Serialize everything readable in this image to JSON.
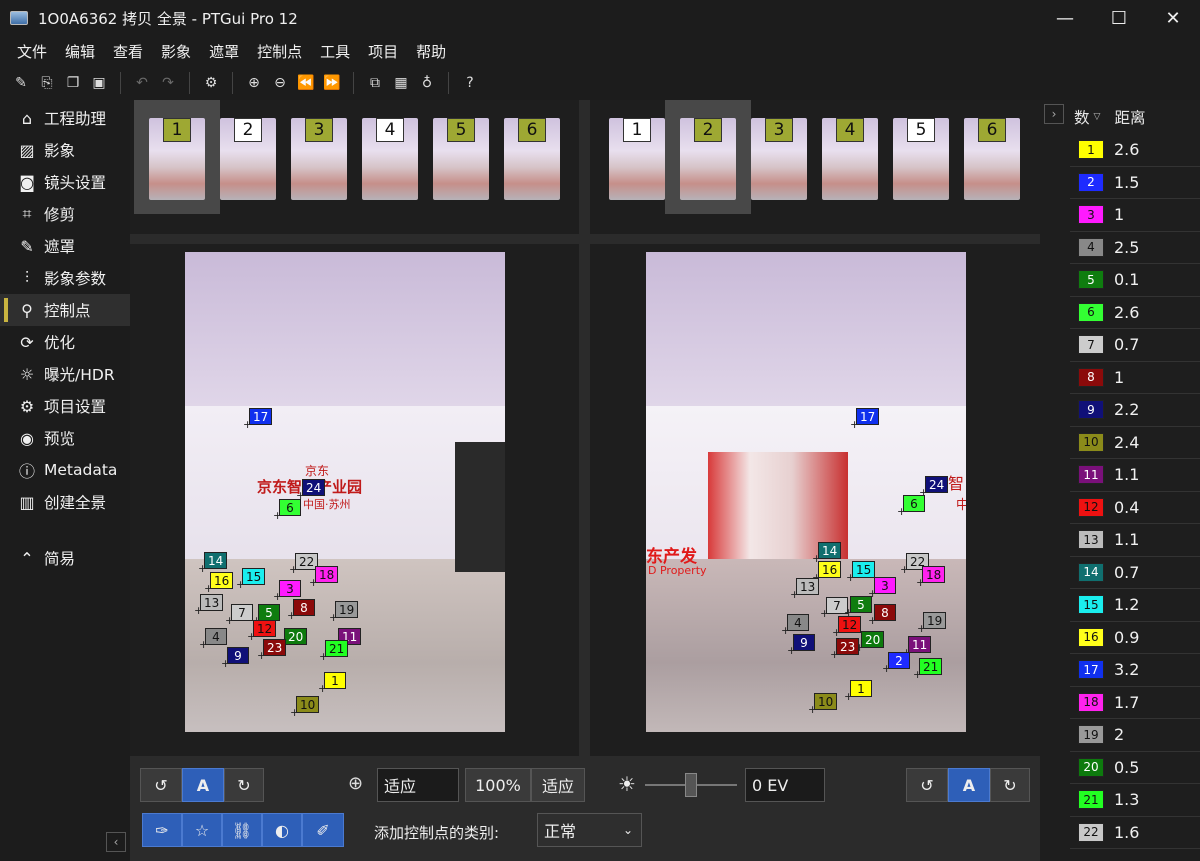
{
  "window": {
    "title": "1O0A6362 拷贝 全景 - PTGui Pro 12",
    "minimize": "—",
    "maximize": "☐",
    "close": "✕"
  },
  "menu": [
    "文件",
    "编辑",
    "查看",
    "影象",
    "遮罩",
    "控制点",
    "工具",
    "项目",
    "帮助"
  ],
  "toolbar_icons": [
    "new-project-icon",
    "edit-icon",
    "copy-icon",
    "save-icon",
    "undo-icon",
    "redo-icon",
    "settings-gear-icon",
    "zoom-in-icon",
    "zoom-out-icon",
    "prev-icon",
    "next-icon",
    "layers-icon",
    "grid-icon",
    "bulb-icon",
    "help-icon"
  ],
  "sidebar": {
    "items": [
      {
        "label": "工程助理",
        "icon": "home-icon",
        "glyph": "⌂"
      },
      {
        "label": "影象",
        "icon": "image-icon",
        "glyph": "▨"
      },
      {
        "label": "镜头设置",
        "icon": "camera-icon",
        "glyph": "◙"
      },
      {
        "label": "修剪",
        "icon": "crop-icon",
        "glyph": "⌗"
      },
      {
        "label": "遮罩",
        "icon": "brush-icon",
        "glyph": "✎"
      },
      {
        "label": "影象参数",
        "icon": "sliders-icon",
        "glyph": "⫶"
      },
      {
        "label": "控制点",
        "icon": "control-points-icon",
        "glyph": "⚲"
      },
      {
        "label": "优化",
        "icon": "refresh-icon",
        "glyph": "⟳"
      },
      {
        "label": "曝光/HDR",
        "icon": "sun-icon",
        "glyph": "☼"
      },
      {
        "label": "项目设置",
        "icon": "settings-icon",
        "glyph": "⚙"
      },
      {
        "label": "预览",
        "icon": "eye-icon",
        "glyph": "◉"
      },
      {
        "label": "Metadata",
        "icon": "info-icon",
        "glyph": "ⓘ"
      },
      {
        "label": "创建全景",
        "icon": "book-icon",
        "glyph": "▥"
      }
    ],
    "active_index": 6,
    "simple_label": "简易"
  },
  "left_thumbs": {
    "selected": 1,
    "items": [
      {
        "n": "1",
        "color": "#9ea833"
      },
      {
        "n": "2",
        "color": "#ffffff"
      },
      {
        "n": "3",
        "color": "#9ea833"
      },
      {
        "n": "4",
        "color": "#ffffff"
      },
      {
        "n": "5",
        "color": "#9ea833"
      },
      {
        "n": "6",
        "color": "#9ea833"
      }
    ]
  },
  "right_thumbs": {
    "selected": 2,
    "items": [
      {
        "n": "1",
        "color": "#ffffff"
      },
      {
        "n": "2",
        "color": "#9ea833"
      },
      {
        "n": "3",
        "color": "#9ea833"
      },
      {
        "n": "4",
        "color": "#9ea833"
      },
      {
        "n": "5",
        "color": "#ffffff"
      },
      {
        "n": "6",
        "color": "#9ea833"
      }
    ]
  },
  "left_photo": {
    "signage": [
      "京东",
      "京东智能产业园",
      "中国·苏州"
    ]
  },
  "right_photo": {
    "signage": [
      "东产发",
      "D Property",
      "智",
      "中"
    ]
  },
  "left_points": [
    "17",
    "24",
    "6",
    "14",
    "16",
    "15",
    "22",
    "18",
    "3",
    "13",
    "7",
    "5",
    "8",
    "19",
    "4",
    "12",
    "20",
    "11",
    "9",
    "23",
    "21",
    "1",
    "10"
  ],
  "right_points": [
    "17",
    "24",
    "6",
    "14",
    "16",
    "15",
    "22",
    "18",
    "3",
    "13",
    "7",
    "5",
    "8",
    "19",
    "4",
    "12",
    "20",
    "11",
    "9",
    "23",
    "2",
    "21",
    "1",
    "10"
  ],
  "bottom": {
    "rotate_left": "↺",
    "auto_a": "A",
    "rotate_right": "↻",
    "zoom_field": "适应",
    "zoom_100": "100%",
    "zoom_fit": "适应",
    "ev": "0 EV",
    "add_type_label": "添加控制点的类别:",
    "add_type_value": "正常",
    "tool_icons": [
      "pin-icon",
      "star-icon",
      "link-icon",
      "contrast-icon",
      "eyedropper-icon"
    ]
  },
  "cp_list": {
    "col_num": "数",
    "col_dist": "距离",
    "rows": [
      {
        "n": "1",
        "color": "#ffff00",
        "d": "2.6"
      },
      {
        "n": "2",
        "color": "#1e2bff",
        "d": "1.5"
      },
      {
        "n": "3",
        "color": "#ff1aff",
        "d": "1"
      },
      {
        "n": "4",
        "color": "#888888",
        "d": "2.5"
      },
      {
        "n": "5",
        "color": "#0f7d0f",
        "d": "0.1"
      },
      {
        "n": "6",
        "color": "#33ff33",
        "d": "2.6"
      },
      {
        "n": "7",
        "color": "#cccccc",
        "d": "0.7"
      },
      {
        "n": "8",
        "color": "#8b0a0a",
        "d": "1"
      },
      {
        "n": "9",
        "color": "#101078",
        "d": "2.2"
      },
      {
        "n": "10",
        "color": "#8b8b1a",
        "d": "2.4"
      },
      {
        "n": "11",
        "color": "#7a107a",
        "d": "1.1"
      },
      {
        "n": "12",
        "color": "#ee1111",
        "d": "0.4"
      },
      {
        "n": "13",
        "color": "#bbbbbb",
        "d": "1.1"
      },
      {
        "n": "14",
        "color": "#106f6f",
        "d": "0.7"
      },
      {
        "n": "15",
        "color": "#1aeeee",
        "d": "1.2"
      },
      {
        "n": "16",
        "color": "#ffff1a",
        "d": "0.9"
      },
      {
        "n": "17",
        "color": "#1030ee",
        "d": "3.2"
      },
      {
        "n": "18",
        "color": "#ff22ee",
        "d": "1.7"
      },
      {
        "n": "19",
        "color": "#999999",
        "d": "2"
      },
      {
        "n": "20",
        "color": "#0d7a0d",
        "d": "0.5"
      },
      {
        "n": "21",
        "color": "#22ff22",
        "d": "1.3"
      },
      {
        "n": "22",
        "color": "#c8c8c8",
        "d": "1.6"
      }
    ]
  }
}
